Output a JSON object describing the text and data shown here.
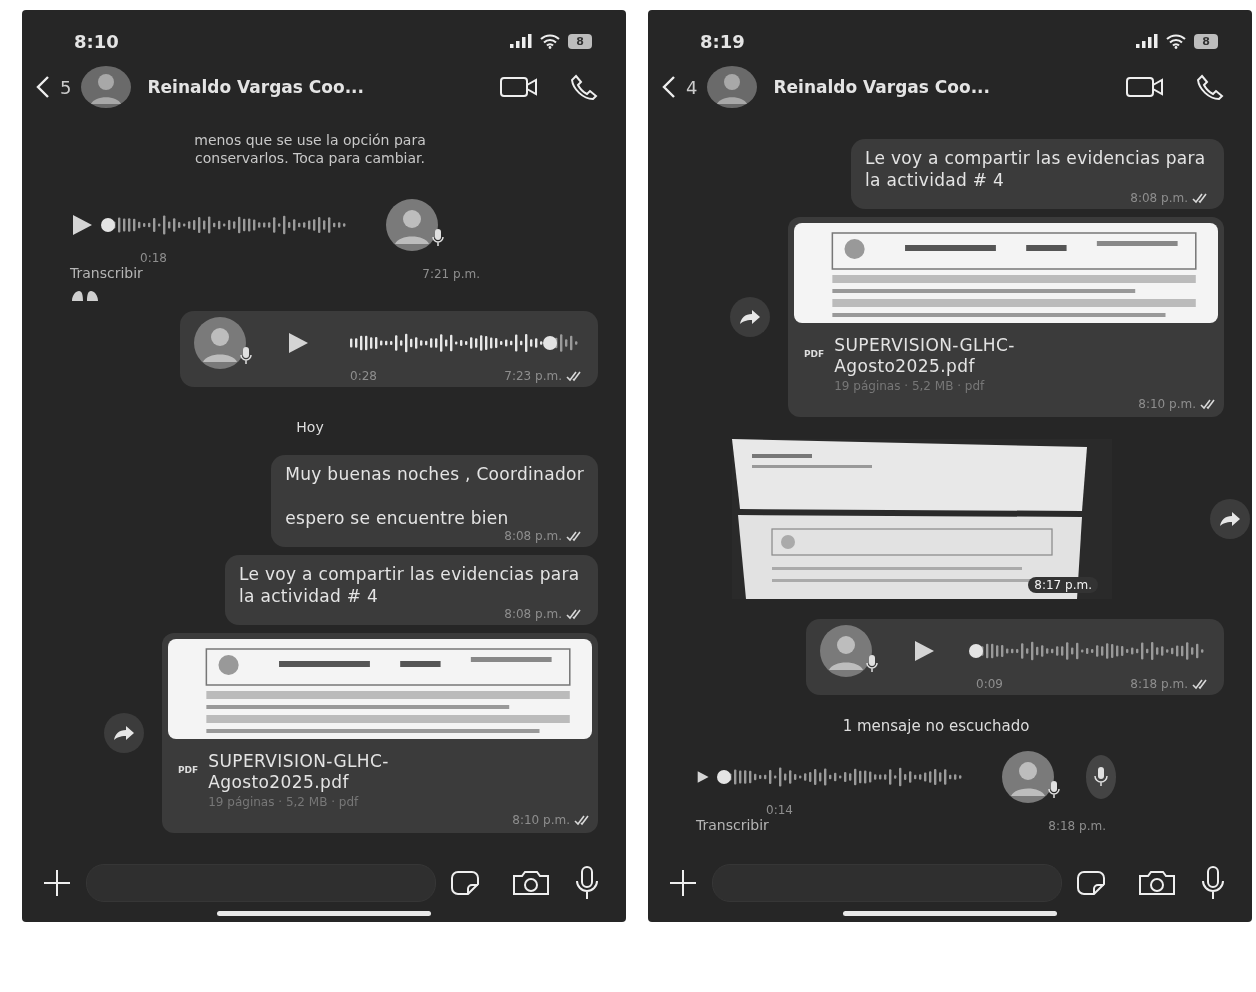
{
  "phones": [
    {
      "status_bar": {
        "time": "8:10",
        "battery": "8"
      },
      "header": {
        "back_count": "5",
        "contact_name": "Reinaldo Vargas Coo..."
      },
      "messages": [
        {
          "kind": "system",
          "text": "menos que se use la opción para conservarlos. Toca para cambiar."
        },
        {
          "kind": "voice_in",
          "duration": "0:18",
          "transcribe": "Transcribir",
          "time": "7:21 p.m.",
          "reaction": true,
          "side_mic_button": false
        },
        {
          "kind": "voice_out",
          "duration": "0:28",
          "time": "7:23 p.m.",
          "level": 0.87,
          "read": true
        },
        {
          "kind": "date",
          "label": "Hoy"
        },
        {
          "kind": "text_out",
          "text": "Muy buenas noches , Coordinador\n\nespero se encuentre bien",
          "time": "8:08 p.m.",
          "read": true
        },
        {
          "kind": "text_out",
          "text": "Le voy a compartir las evidencias para la actividad # 4",
          "time": "8:08 p.m.",
          "read": true
        },
        {
          "kind": "document_out",
          "file_type": "PDF",
          "file_name": "SUPERVISION-GLHC-Agosto2025.pdf",
          "meta": "19 páginas · 5,2 MB · pdf",
          "time": "8:10 p.m.",
          "read": true
        }
      ]
    },
    {
      "status_bar": {
        "time": "8:19",
        "battery": "8"
      },
      "header": {
        "back_count": "4",
        "contact_name": "Reinaldo Vargas Coo..."
      },
      "messages": [
        {
          "kind": "text_out",
          "text": "Le voy a compartir las evidencias para la actividad # 4",
          "time": "8:08 p.m.",
          "read": true
        },
        {
          "kind": "document_out",
          "file_type": "PDF",
          "file_name": "SUPERVISION-GLHC-Agosto2025.pdf",
          "meta": "19 páginas · 5,2 MB · pdf",
          "time": "8:10 p.m.",
          "read": true
        },
        {
          "kind": "image_in",
          "time": "8:17 p.m."
        },
        {
          "kind": "voice_out",
          "duration": "0:09",
          "time": "8:18 p.m.",
          "read": true
        },
        {
          "kind": "unread",
          "label": "1 mensaje no escuchado"
        },
        {
          "kind": "voice_in",
          "duration": "0:14",
          "transcribe": "Transcribir",
          "time": "8:18 p.m.",
          "reaction": false,
          "side_mic_button": true
        }
      ]
    }
  ]
}
